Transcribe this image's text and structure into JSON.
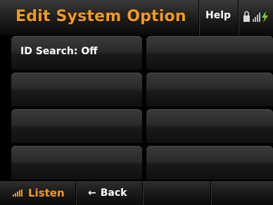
{
  "header": {
    "title": "Edit System Option",
    "help_label": "Help"
  },
  "status_icons": [
    "lock-icon",
    "signal-bars-icon",
    "charging-bolt-icon"
  ],
  "options": [
    {
      "label": "ID Search: Off"
    },
    {
      "label": ""
    },
    {
      "label": ""
    },
    {
      "label": ""
    },
    {
      "label": ""
    },
    {
      "label": ""
    },
    {
      "label": ""
    },
    {
      "label": ""
    }
  ],
  "bottom": {
    "listen_label": "Listen",
    "back_label": "Back",
    "back_arrow": "←"
  },
  "colors": {
    "accent": "#f29a1c",
    "text": "#ffffff",
    "background": "#000000",
    "bolt": "#7ed321"
  }
}
